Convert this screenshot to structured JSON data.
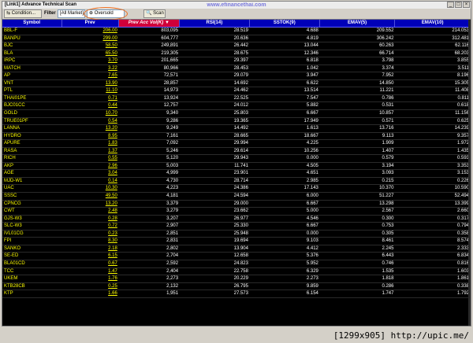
{
  "window": {
    "title": "[Link1] Advance Technical Scan",
    "watermark": "www.efinancethai.com"
  },
  "toolbar": {
    "condition_label": "Condition...",
    "filter_label": "Filter :",
    "filter_value": "[All Market]",
    "preset_value": "Oversold",
    "scan_label": "Scan"
  },
  "table": {
    "columns": [
      "Symbol",
      "Prev",
      "Prev Acc Vol(K)",
      "RSI(14)",
      "SSTOK(9)",
      "EMAV(5)",
      "EMAV(10)"
    ],
    "rows": [
      [
        "BBL-F",
        "206.00",
        "803,095",
        "28.519",
        "4.688",
        "209.552",
        "214.053"
      ],
      [
        "BANPU",
        "299.00",
        "604,777",
        "20.636",
        "4.819",
        "306.242",
        "312.481"
      ],
      [
        "BJC",
        "58.50",
        "249,891",
        "26.442",
        "13.044",
        "60.263",
        "62.116"
      ],
      [
        "BLA",
        "65.50",
        "219,305",
        "28.675",
        "12.346",
        "66.714",
        "68.203"
      ],
      [
        "IRPC",
        "3.70",
        "201,665",
        "29.397",
        "6.818",
        "3.798",
        "3.855"
      ],
      [
        "MATCH",
        "3.22",
        "80,966",
        "28.453",
        "1.042",
        "3.374",
        "3.511"
      ],
      [
        "AP",
        "7.65",
        "72,571",
        "29.079",
        "3.947",
        "7.952",
        "8.196"
      ],
      [
        "VNT",
        "13.90",
        "28,857",
        "14.692",
        "6.622",
        "14.850",
        "15.305"
      ],
      [
        "PTL",
        "11.10",
        "14,973",
        "24.462",
        "13.514",
        "11.221",
        "11.408"
      ],
      [
        "THAI01PE",
        "0.71",
        "13,924",
        "22.525",
        "7.547",
        "0.786",
        "0.811"
      ],
      [
        "BJC01CC",
        "0.44",
        "12,757",
        "24.012",
        "5.882",
        "0.531",
        "0.618"
      ],
      [
        "GOLD",
        "10.70",
        "9,340",
        "25.803",
        "6.667",
        "10.857",
        "11.156"
      ],
      [
        "TRUE01PF",
        "0.54",
        "9,286",
        "19.365",
        "17.949",
        "0.571",
        "0.625"
      ],
      [
        "LANNA",
        "13.20",
        "9,249",
        "14.492",
        "1.613",
        "13.716",
        "14.239"
      ],
      [
        "HYDRO",
        "8.95",
        "7,161",
        "28.665",
        "18.667",
        "9.113",
        "9.357"
      ],
      [
        "APURE",
        "1.83",
        "7,092",
        "29.994",
        "4.225",
        "1.909",
        "1.972"
      ],
      [
        "RASA",
        "1.37",
        "5,246",
        "29.614",
        "10.256",
        "1.407",
        "1.435"
      ],
      [
        "RICH",
        "0.55",
        "5,120",
        "29.943",
        "0.000",
        "0.579",
        "0.593"
      ],
      [
        "AKP",
        "2.96",
        "5,003",
        "11.741",
        "4.505",
        "3.194",
        "3.353"
      ],
      [
        "AGE",
        "3.04",
        "4,999",
        "23.901",
        "4.651",
        "3.093",
        "3.153"
      ],
      [
        "MJD-W1",
        "0.14",
        "4,730",
        "28.714",
        "2.985",
        "0.215",
        "0.226"
      ],
      [
        "UAC",
        "10.30",
        "4,223",
        "24.386",
        "17.143",
        "10.370",
        "10.590"
      ],
      [
        "SSSC",
        "49.50",
        "4,181",
        "24.594",
        "6.000",
        "51.227",
        "52.494"
      ],
      [
        "CPNCG",
        "13.20",
        "3,379",
        "29.000",
        "6.667",
        "13.298",
        "13.399"
      ],
      [
        "CWT",
        "2.48",
        "3,279",
        "23.662",
        "5.000",
        "2.567",
        "2.660"
      ],
      [
        "GJS-W3",
        "0.28",
        "3,207",
        "26.977",
        "4.546",
        "0.300",
        "0.317"
      ],
      [
        "SLC-W3",
        "0.72",
        "2,907",
        "25.330",
        "6.667",
        "0.753",
        "0.794"
      ],
      [
        "IVL01CG",
        "0.23",
        "2,851",
        "25.948",
        "0.000",
        "0.305",
        "0.358"
      ],
      [
        "FPI",
        "8.30",
        "2,831",
        "19.694",
        "9.103",
        "8.461",
        "8.574"
      ],
      [
        "SANKO",
        "2.18",
        "2,802",
        "13.904",
        "4.412",
        "2.245",
        "2.333"
      ],
      [
        "SE-ED",
        "6.15",
        "2,704",
        "12.658",
        "5.376",
        "6.443",
        "6.834"
      ],
      [
        "BLA01CD",
        "0.67",
        "2,592",
        "24.823",
        "5.952",
        "0.746",
        "0.816"
      ],
      [
        "TCC",
        "1.47",
        "2,404",
        "22.758",
        "6.329",
        "1.535",
        "1.603"
      ],
      [
        "UKEM",
        "1.76",
        "2,273",
        "20.229",
        "2.273",
        "1.818",
        "1.861"
      ],
      [
        "KTB28CB",
        "0.25",
        "2,132",
        "26.795",
        "9.859",
        "0.286",
        "0.338"
      ],
      [
        "KTP",
        "1.66",
        "1,951",
        "27.573",
        "6.154",
        "1.747",
        "1.792"
      ]
    ]
  },
  "caption": "[1299x905] http://upic.me/"
}
